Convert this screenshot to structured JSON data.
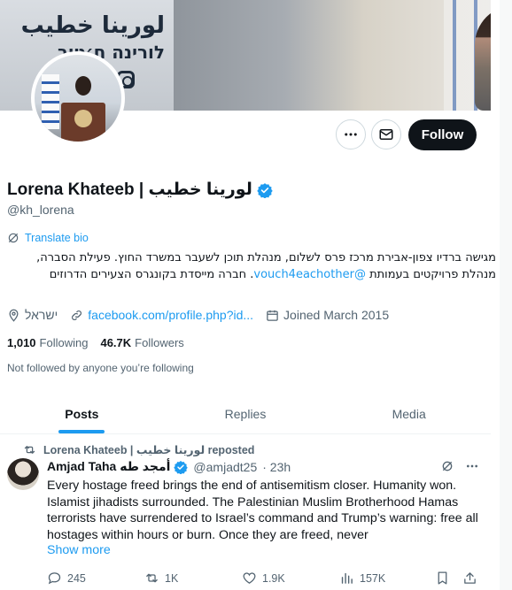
{
  "banner": {
    "brand_arabic": "لورينا خطيب",
    "brand_hebrew": "לורינה ח׳טיב"
  },
  "profile": {
    "display_name": "Lorena Khateeb | لورينا خطيب",
    "handle": "@kh_lorena",
    "translate_label": "Translate bio",
    "bio_part1": "מגישה ברדיו צפון-אבירת מרכז פרס לשלום, מנהלת תוכן לשעבר במשרד החוץ. פעילת הסברה, מנהלת פרויקטים בעמותת ",
    "bio_mention": "@vouch4eachother",
    "bio_part2": ". חברה מייסדת בקונגרס הצעירים הדרוזים",
    "location": "ישראל",
    "website": "facebook.com/profile.php?id...",
    "joined": "Joined March 2015",
    "following_count": "1,010",
    "following_label": "Following",
    "followers_count": "46.7K",
    "followers_label": "Followers",
    "not_followed_text": "Not followed by anyone you’re following"
  },
  "actions": {
    "follow_label": "Follow"
  },
  "tabs": [
    {
      "label": "Posts",
      "active": true
    },
    {
      "label": "Replies",
      "active": false
    },
    {
      "label": "Media",
      "active": false
    }
  ],
  "tweet": {
    "repost_text": "Lorena Khateeb | لورينا خطيب reposted",
    "author_name": "Amjad Taha أمجد طه",
    "author_handle": "@amjadt25",
    "time": "· 23h",
    "text": "Every hostage freed brings the end of antisemitism closer. Humanity won. Islamist jihadists surrounded. The Palestinian Muslim Brotherhood Hamas terrorists have surrendered to Israel’s command and Trump’s warning: free all hostages within hours or burn. Once they are freed, never",
    "show_more": "Show more",
    "replies": "245",
    "retweets": "1K",
    "likes": "1.9K",
    "views": "157K"
  },
  "colors": {
    "accent": "#1d9bf0",
    "text_primary": "#0f1419",
    "text_secondary": "#536471",
    "follow_bg": "#0f1419"
  }
}
